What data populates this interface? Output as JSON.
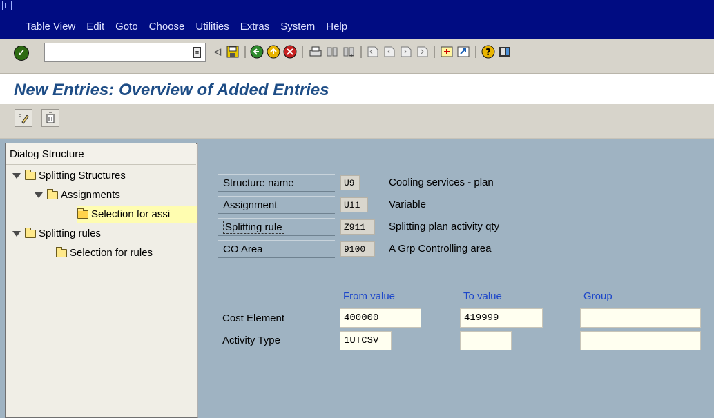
{
  "menu": [
    "Table View",
    "Edit",
    "Goto",
    "Choose",
    "Utilities",
    "Extras",
    "System",
    "Help"
  ],
  "command_field": {
    "value": ""
  },
  "page_title": "New Entries: Overview of Added Entries",
  "dialog_structure": {
    "header": "Dialog Structure",
    "nodes": [
      {
        "label": "Splitting Structures"
      },
      {
        "label": "Assignments"
      },
      {
        "label": "Selection for assi"
      },
      {
        "label": "Splitting rules"
      },
      {
        "label": "Selection for rules"
      }
    ]
  },
  "keys": [
    {
      "label": "Structure name",
      "value": "U9",
      "text": "Cooling services - plan"
    },
    {
      "label": "Assignment",
      "value": "U11",
      "text": "Variable"
    },
    {
      "label": "Splitting rule",
      "value": "Z911",
      "text": "Splitting plan activity qty"
    },
    {
      "label": "CO Area",
      "value": "9100",
      "text": "A Grp Controlling area"
    }
  ],
  "table": {
    "columns": [
      "From value",
      "To value",
      "Group"
    ],
    "rows": [
      {
        "label": "Cost Element",
        "from": "400000",
        "to": "419999",
        "group": ""
      },
      {
        "label": "Activity Type",
        "from": "1UTCSV",
        "to": "",
        "group": ""
      }
    ]
  },
  "colors": {
    "title": "#1e4d86",
    "menubar": "#000c82",
    "column_header": "#1d47c9",
    "background": "#9fb3c2"
  }
}
